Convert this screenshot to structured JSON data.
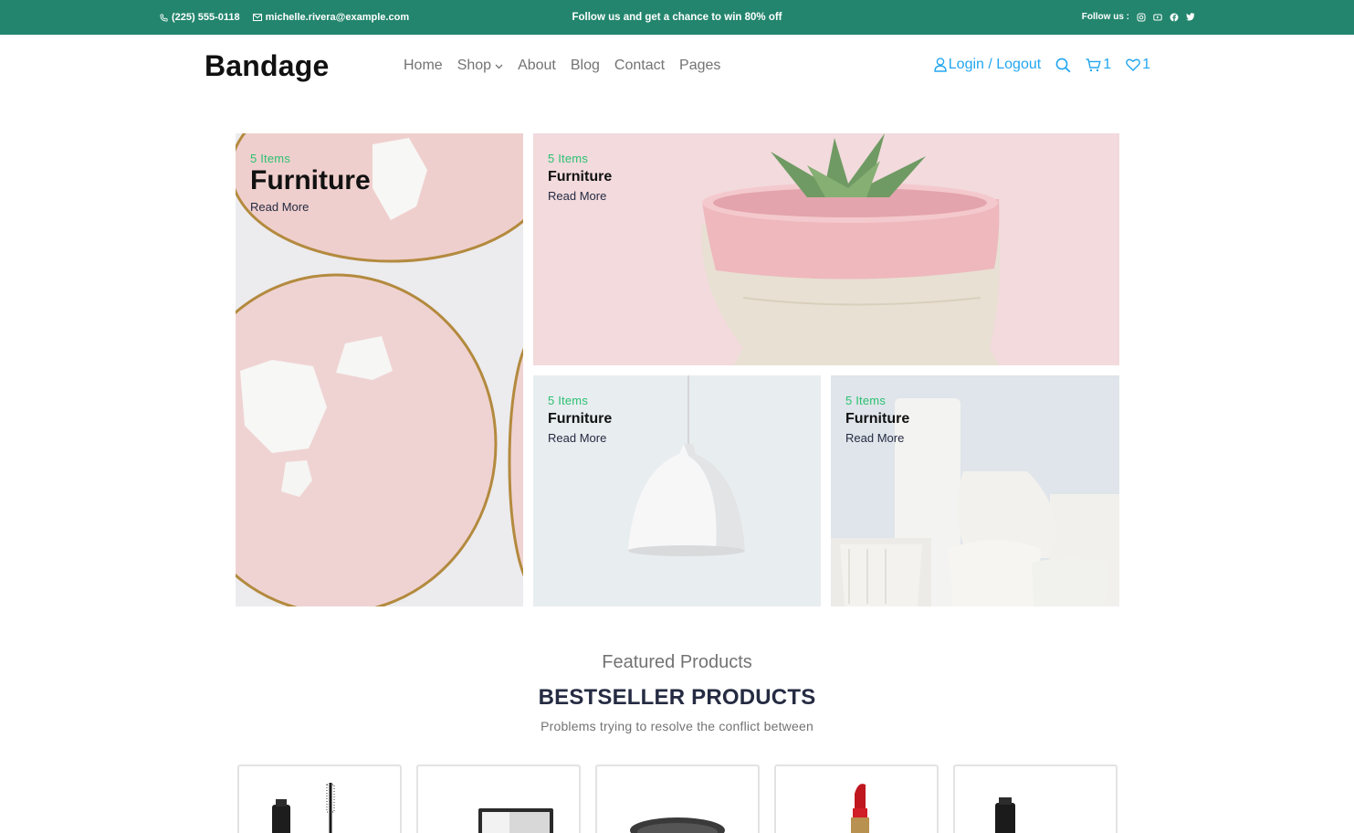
{
  "topbar": {
    "phone": "(225) 555-0118",
    "email": "michelle.rivera@example.com",
    "promo": "Follow us and get a chance to win 80% off",
    "follow_label": "Follow us :",
    "social_icons": [
      "instagram-icon",
      "youtube-icon",
      "facebook-icon",
      "twitter-icon"
    ]
  },
  "navbar": {
    "brand": "Bandage",
    "links": [
      {
        "label": "Home"
      },
      {
        "label": "Shop"
      },
      {
        "label": "About"
      },
      {
        "label": "Blog"
      },
      {
        "label": "Contact"
      },
      {
        "label": "Pages"
      }
    ],
    "login_label": "Login / Logout",
    "cart_count": "1",
    "wishlist_count": "1"
  },
  "categories": [
    {
      "items": "5 Items",
      "title": "Furniture",
      "more": "Read More"
    },
    {
      "items": "5 Items",
      "title": "Furniture",
      "more": "Read More"
    },
    {
      "items": "5 Items",
      "title": "Furniture",
      "more": "Read More"
    },
    {
      "items": "5 Items",
      "title": "Furniture",
      "more": "Read More"
    }
  ],
  "featured": {
    "subtitle": "Featured Products",
    "title": "BESTSELLER PRODUCTS",
    "description": "Problems trying to resolve the conflict between"
  },
  "colors": {
    "topbar": "#23856d",
    "accent": "#23a6f0",
    "success": "#2dc071",
    "heading": "#252b42",
    "muted": "#737373"
  }
}
